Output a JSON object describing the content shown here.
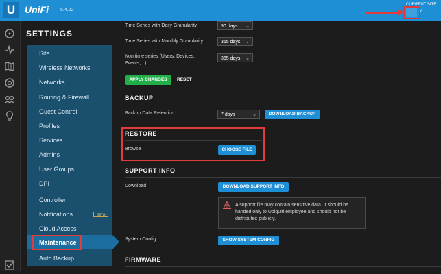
{
  "header": {
    "brand": "UniFi",
    "version": "5.4.22",
    "current_site_label": "CURRENT SITE",
    "current_site_chevron": "v"
  },
  "icons": {
    "left_nav": [
      "dashboard-icon",
      "statistics-icon",
      "map-icon",
      "devices-icon",
      "clients-icon",
      "insights-icon",
      "tasks-icon"
    ]
  },
  "sidebar": {
    "title": "SETTINGS",
    "group1": [
      "Site",
      "Wireless Networks",
      "Networks",
      "Routing & Firewall",
      "Guest Control",
      "Profiles",
      "Services",
      "Admins",
      "User Groups",
      "DPI"
    ],
    "group2": [
      "Controller",
      "Notifications",
      "Cloud Access",
      "Maintenance",
      "Auto Backup"
    ],
    "beta_badge": "BETA",
    "selected": "Maintenance"
  },
  "main": {
    "daily_label": "Time Series with Daily Granularity",
    "daily_value": "90 days",
    "monthly_label": "Time Series with Monthly Granularity",
    "monthly_value": "365 days",
    "nontime_label_line1": "Non time series (Users, Devices,",
    "nontime_label_line2": "Events,...)",
    "nontime_value": "365 days",
    "apply_button": "APPLY CHANGES",
    "reset_button": "RESET",
    "backup": {
      "title": "BACKUP",
      "retention_label": "Backup Data Retention",
      "retention_value": "7 days",
      "download_button": "DOWNLOAD BACKUP"
    },
    "restore": {
      "title": "RESTORE",
      "browse_label": "Browse",
      "choose_button": "CHOOSE FILE"
    },
    "support": {
      "title": "SUPPORT INFO",
      "download_label": "Download",
      "download_button": "DOWNLOAD SUPPORT INFO",
      "warning_text": "A support file may contain sensitive data. It should be handed only to Ubiquiti employee and should not be distributed publicly.",
      "system_config_label": "System Config",
      "show_config_button": "SHOW SYSTEM CONFIG"
    },
    "firmware": {
      "title": "FIRMWARE"
    }
  },
  "colors": {
    "topbar": "#1e8fd5",
    "sidebar_group": "#1a4f6e",
    "selected": "#1c6da0",
    "apply_green": "#23b04b",
    "highlight_red": "#e23b3b"
  }
}
